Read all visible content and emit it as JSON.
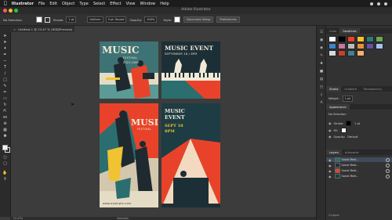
{
  "menubar": {
    "app_name": "Illustrator",
    "items": [
      "File",
      "Edit",
      "Object",
      "Type",
      "Select",
      "Effect",
      "View",
      "Window",
      "Help"
    ]
  },
  "window": {
    "title": "Adobe Illustrator"
  },
  "control_bar": {
    "selection_label": "No Selection",
    "stroke_label": "Stroke:",
    "stroke_value": "1 pt",
    "profile_value": "Uniform",
    "brush_value": "5 pt. Round",
    "opacity_label": "Opacity:",
    "opacity_value": "100%",
    "style_label": "Style:",
    "document_setup_button": "Document Setup",
    "preferences_button": "Preferences"
  },
  "document": {
    "tab_title": "Untitled-1 @ 23.47 % (RGB/Preview)"
  },
  "posters": {
    "p1_title": "MUSIC",
    "p1_sub1": "FESTIVAL",
    "p1_sub2": "2021 JUNE",
    "p2_title": "MUSIC EVENT",
    "p2_sub": "SEPTEMBER 18 / 8PM",
    "p3_title": "MUSIC",
    "p3_sub": "FESTIVAL",
    "p3_footer": "www.example.com",
    "p4_title1": "MUSIC",
    "p4_title2": "EVENT",
    "p4_sub1": "SEPT 18",
    "p4_sub2": "8PM"
  },
  "status_bar": {
    "zoom": "23.47%",
    "mode": "Selection"
  },
  "panels": {
    "top_tabs": [
      "Color",
      "Swatches"
    ],
    "stroke_tabs": [
      "Stroke",
      "Gradient",
      "Transparency"
    ],
    "weight_label": "Weight:",
    "weight_value": "1 pt",
    "appearance_title": "Appearance",
    "appearance_no_selection": "No Selection",
    "appearance_stroke_label": "Stroke:",
    "appearance_stroke_value": "1 pt",
    "appearance_fill_label": "Fill:",
    "appearance_opacity_label": "Opacity:",
    "appearance_opacity_value": "Default",
    "layers_tabs": [
      "Layers",
      "Artboards"
    ],
    "layers": [
      "Social Medi...",
      "Social Medi...",
      "Social Medi...",
      "Social Medi..."
    ],
    "layers_count": "4 Layers"
  },
  "swatch_colors": [
    "#ffffff",
    "#000000",
    "#e8432a",
    "#f1c232",
    "#2b7a78",
    "#6aa84f",
    "#3d85c6",
    "#c27ba0",
    "#bbbbbb",
    "#e69138",
    "#674ea7",
    "#9fc5e8",
    "#d9d9d9",
    "#cc4125",
    "#45818e",
    "#f6b26b"
  ],
  "colors": {
    "accent": "#e8432a",
    "teal": "#2b6e6f",
    "navy": "#1d2f36",
    "cream": "#f1e9d8"
  },
  "icons": [
    "apple-icon",
    "selection-tool-icon",
    "direct-selection-tool-icon",
    "pen-tool-icon",
    "type-tool-icon",
    "line-tool-icon",
    "rectangle-tool-icon",
    "brush-tool-icon",
    "pencil-tool-icon",
    "eraser-tool-icon",
    "rotate-tool-icon",
    "scale-tool-icon",
    "width-tool-icon",
    "shape-builder-icon",
    "gradient-tool-icon",
    "eyedropper-tool-icon",
    "hand-tool-icon",
    "zoom-tool-icon",
    "eye-icon",
    "wifi-icon",
    "search-icon"
  ]
}
